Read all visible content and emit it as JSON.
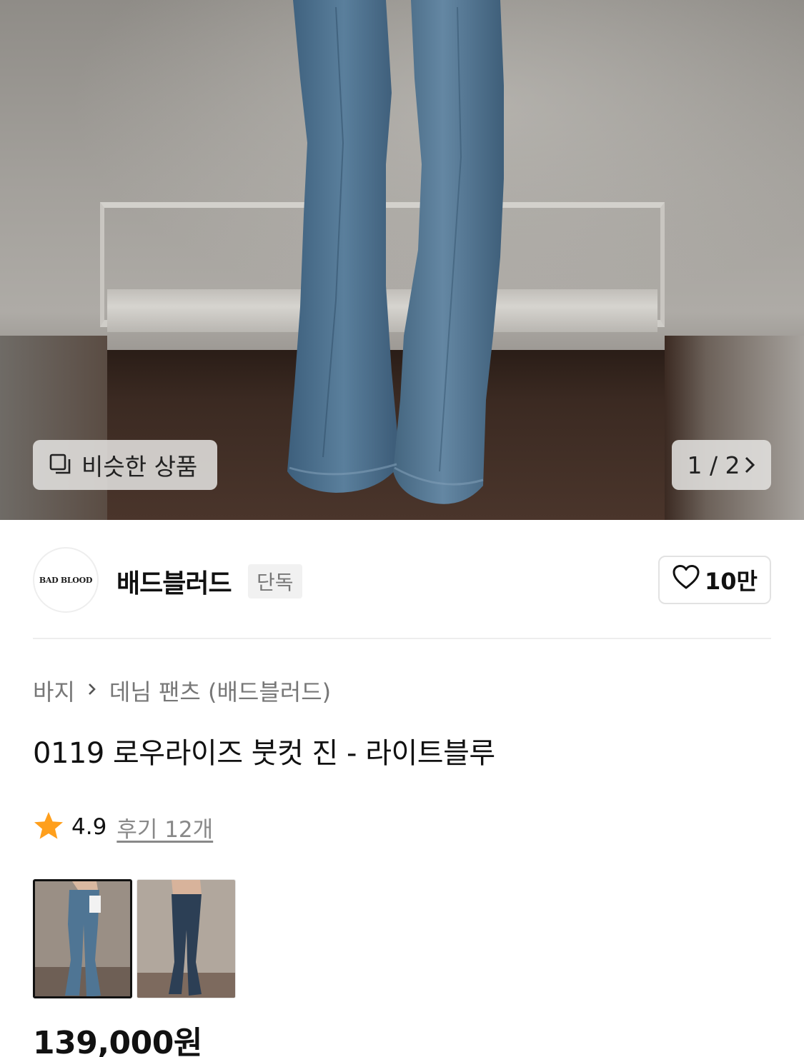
{
  "hero": {
    "similar_button_label": "비슷한 상품",
    "page_counter": "1 / 2"
  },
  "brand": {
    "logo_text": "BAD BLOOD",
    "name": "배드블러드",
    "tag": "단독",
    "like_count": "10만"
  },
  "breadcrumb": {
    "category": "바지",
    "subcategory": "데님 팬츠 (배드블러드)"
  },
  "product": {
    "title": "0119 로우라이즈 붓컷 진 - 라이트블루",
    "rating": "4.9",
    "review_link": "후기 12개",
    "price": "139,000원"
  },
  "thumbnails": [
    {
      "name": "light-blue",
      "selected": true
    },
    {
      "name": "dark-blue",
      "selected": false
    }
  ],
  "colors": {
    "star": "#FF9F1C",
    "denim_light": "#4f7594",
    "denim_dark": "#2c3f55"
  }
}
